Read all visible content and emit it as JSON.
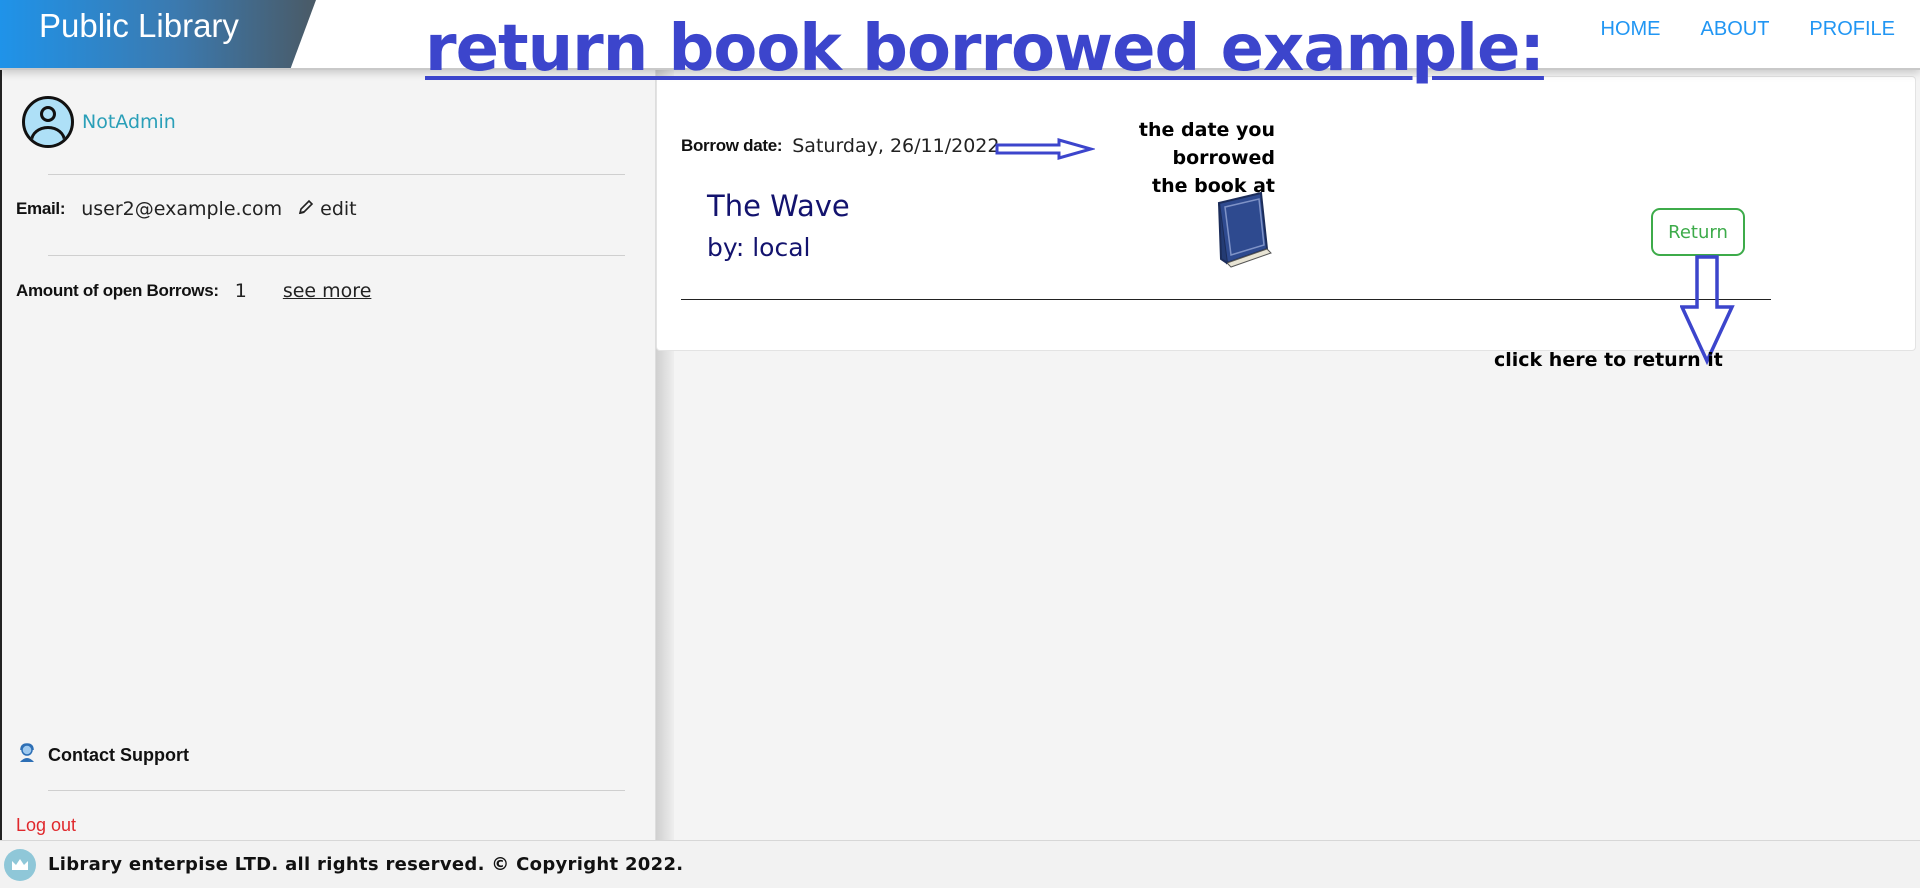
{
  "header": {
    "brand": "Public Library",
    "nav": [
      "HOME",
      "ABOUT",
      "PROFILE"
    ]
  },
  "annotation": {
    "title": "return book borrowed example:",
    "date_note": [
      "the date you borrowed",
      "the book at"
    ],
    "return_note": "click here to return it"
  },
  "sidebar": {
    "username": "NotAdmin",
    "email_label": "Email:",
    "email_value": "user2@example.com",
    "edit_label": "edit",
    "borrows_label": "Amount of open Borrows:",
    "borrows_count": "1",
    "see_more_label": "see more",
    "support_label": "Contact Support",
    "logout_label": "Log out"
  },
  "borrow": {
    "date_label": "Borrow date:",
    "date_value": "Saturday, 26/11/2022",
    "book_title": "The Wave",
    "book_author": "by: local",
    "return_label": "Return"
  },
  "footer": {
    "text": "Library enterpise LTD. all rights reserved. © Copyright 2022."
  },
  "colors": {
    "accent": "#2196f3",
    "annotation": "#3c45cc",
    "return": "#3dab4a",
    "logout": "#e0282c",
    "book_text": "#13136e"
  },
  "icons": {
    "avatar": "user-circle-icon",
    "edit": "pencil-icon",
    "support": "support-agent-icon",
    "footer_logo": "crown-icon",
    "book": "book-icon"
  }
}
